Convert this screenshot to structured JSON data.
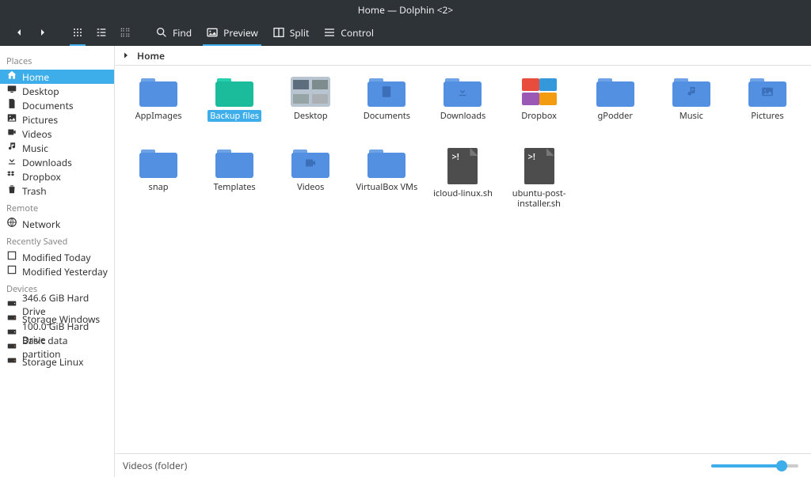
{
  "window_title": "Home — Dolphin <2>",
  "toolbar": {
    "find_label": "Find",
    "preview_label": "Preview",
    "split_label": "Split",
    "control_label": "Control"
  },
  "breadcrumb": {
    "current": "Home"
  },
  "sidebar": {
    "sections": {
      "places": "Places",
      "remote": "Remote",
      "recent": "Recently Saved",
      "devices": "Devices"
    },
    "places": [
      {
        "icon": "home",
        "label": "Home",
        "selected": true
      },
      {
        "icon": "desktop",
        "label": "Desktop"
      },
      {
        "icon": "document",
        "label": "Documents"
      },
      {
        "icon": "picture",
        "label": "Pictures"
      },
      {
        "icon": "video",
        "label": "Videos"
      },
      {
        "icon": "music",
        "label": "Music"
      },
      {
        "icon": "download",
        "label": "Downloads"
      },
      {
        "icon": "dropbox",
        "label": "Dropbox"
      },
      {
        "icon": "trash",
        "label": "Trash"
      }
    ],
    "remote": [
      {
        "icon": "network",
        "label": "Network"
      }
    ],
    "recent": [
      {
        "icon": "checkbox",
        "label": "Modified Today"
      },
      {
        "icon": "checkbox",
        "label": "Modified Yesterday"
      }
    ],
    "devices": [
      {
        "icon": "drive",
        "label": "346.6 GiB Hard Drive"
      },
      {
        "icon": "drive-ext",
        "label": "Storage Windows"
      },
      {
        "icon": "drive",
        "label": "100.0 GiB Hard Drive"
      },
      {
        "icon": "drive-ext",
        "label": "Basic data partition"
      },
      {
        "icon": "drive-ext",
        "label": "Storage Linux"
      }
    ]
  },
  "files": [
    {
      "name": "AppImages",
      "type": "folder"
    },
    {
      "name": "Backup files",
      "type": "folder",
      "color": "cyan",
      "selected": true
    },
    {
      "name": "Desktop",
      "type": "desktop"
    },
    {
      "name": "Documents",
      "type": "folder",
      "glyph": "document"
    },
    {
      "name": "Downloads",
      "type": "folder",
      "glyph": "download"
    },
    {
      "name": "Dropbox",
      "type": "dropbox"
    },
    {
      "name": "gPodder",
      "type": "folder"
    },
    {
      "name": "Music",
      "type": "folder",
      "glyph": "music"
    },
    {
      "name": "Pictures",
      "type": "folder",
      "glyph": "picture"
    },
    {
      "name": "snap",
      "type": "folder"
    },
    {
      "name": "Templates",
      "type": "folder"
    },
    {
      "name": "Videos",
      "type": "folder",
      "glyph": "video"
    },
    {
      "name": "VirtualBox VMs",
      "type": "folder"
    },
    {
      "name": "icloud-linux.sh",
      "type": "shell"
    },
    {
      "name": "ubuntu-post-installer.sh",
      "type": "shell"
    }
  ],
  "statusbar": {
    "text": "Videos (folder)"
  }
}
